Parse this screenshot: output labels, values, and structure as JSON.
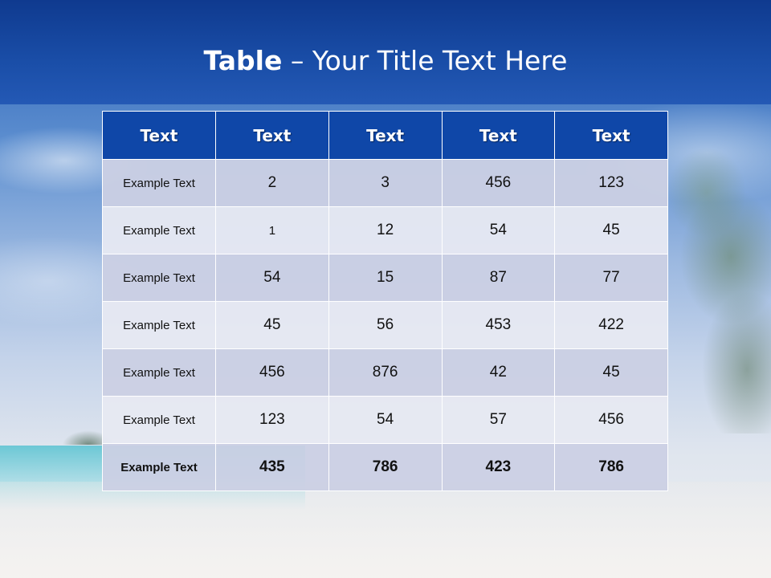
{
  "slide": {
    "title_bold": "Table",
    "title_rest": " – Your Title Text Here"
  },
  "table": {
    "headers": [
      "Text",
      "Text",
      "Text",
      "Text",
      "Text"
    ],
    "rows": [
      [
        "Example Text",
        "2",
        "3",
        "456",
        "123"
      ],
      [
        "Example Text",
        "1",
        "12",
        "54",
        "45"
      ],
      [
        "Example Text",
        "54",
        "15",
        "87",
        "77"
      ],
      [
        "Example Text",
        "45",
        "56",
        "453",
        "422"
      ],
      [
        "Example Text",
        "456",
        "876",
        "42",
        "45"
      ],
      [
        "Example Text",
        "123",
        "54",
        "57",
        "456"
      ],
      [
        "Example Text",
        "435",
        "786",
        "423",
        "786"
      ]
    ]
  },
  "colors": {
    "header_fill": "#0f47a8",
    "row_odd": "#cbd0e4",
    "row_even": "#e7e9f2",
    "title_text": "#ffffff"
  }
}
